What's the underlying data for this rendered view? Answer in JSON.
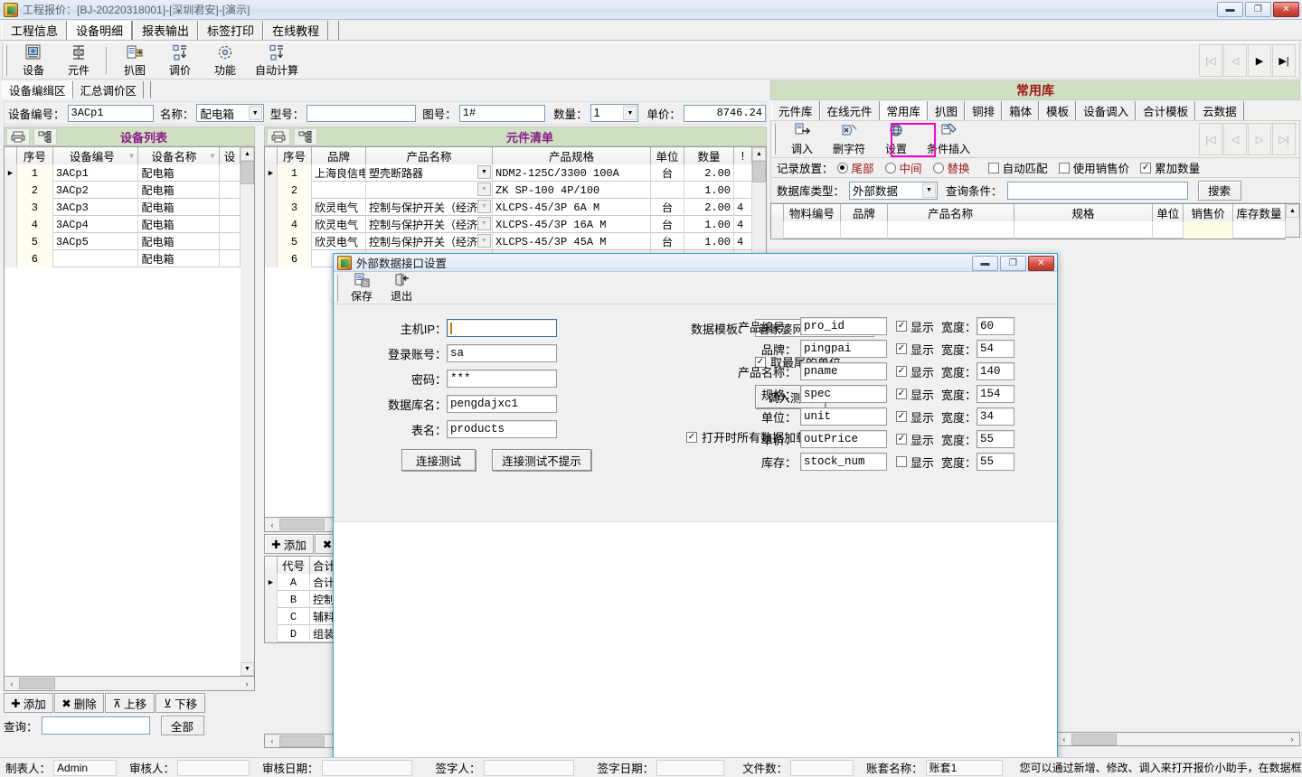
{
  "window": {
    "title": "工程报价：[BJ-20220318001]-[深圳君安]-[演示]",
    "minimize": "—",
    "maximize": "❐",
    "close": "✕"
  },
  "menu_tabs": [
    {
      "label": "工程信息",
      "active": false
    },
    {
      "label": "设备明细",
      "active": true
    },
    {
      "label": "报表输出",
      "active": false
    },
    {
      "label": "标签打印",
      "active": false
    },
    {
      "label": "在线教程",
      "active": false
    }
  ],
  "toolbar": {
    "buttons": [
      {
        "label": "设备",
        "icon": "device-icon"
      },
      {
        "label": "元件",
        "icon": "component-icon"
      },
      {
        "label": "扒图",
        "icon": "extract-image-icon"
      },
      {
        "label": "调价",
        "icon": "price-adjust-icon"
      },
      {
        "label": "功能",
        "icon": "function-icon"
      },
      {
        "label": "自动计算",
        "icon": "auto-calc-icon"
      }
    ],
    "nav": [
      {
        "label": "|◁",
        "name": "nav-first-button",
        "dim": true
      },
      {
        "label": "◁",
        "name": "nav-prev-button",
        "dim": true
      },
      {
        "label": "▶",
        "name": "nav-next-button",
        "dim": false
      },
      {
        "label": "▶|",
        "name": "nav-last-button",
        "dim": false
      }
    ]
  },
  "sub_tabs": [
    {
      "label": "设备编缉区",
      "active": true
    },
    {
      "label": "汇总调价区",
      "active": false
    }
  ],
  "field_row": {
    "device_no_label": "设备编号：",
    "device_no_value": "3ACp1",
    "name_label": "名称：",
    "name_value": "配电箱",
    "model_label": "型号：",
    "model_value": "",
    "drawing_label": "图号：",
    "drawing_value": "1#",
    "qty_label": "数量：",
    "qty_value": "1",
    "price_label": "单价：",
    "price_value": "8746.24"
  },
  "device_panel": {
    "title": "设备列表",
    "columns": [
      "",
      "序号",
      "设备编号",
      "设备名称",
      "设"
    ],
    "rows": [
      {
        "mark": "▶",
        "seq": "1",
        "no": "3ACp1",
        "name": "配电箱",
        "extra": ""
      },
      {
        "mark": "",
        "seq": "2",
        "no": "3ACp2",
        "name": "配电箱",
        "extra": ""
      },
      {
        "mark": "",
        "seq": "3",
        "no": "3ACp3",
        "name": "配电箱",
        "extra": ""
      },
      {
        "mark": "",
        "seq": "4",
        "no": "3ACp4",
        "name": "配电箱",
        "extra": ""
      },
      {
        "mark": "",
        "seq": "5",
        "no": "3ACp5",
        "name": "配电箱",
        "extra": ""
      },
      {
        "mark": "",
        "seq": "6",
        "no": "",
        "name": "配电箱",
        "extra": ""
      }
    ],
    "buttons": [
      {
        "label": "添加",
        "icon": "plus-icon"
      },
      {
        "label": "删除",
        "icon": "cross-icon"
      },
      {
        "label": "上移",
        "icon": "move-up-icon"
      },
      {
        "label": "下移",
        "icon": "move-down-icon"
      }
    ],
    "query_label": "查询：",
    "query_value": "",
    "all_button": "全部"
  },
  "component_panel": {
    "title": "元件清单",
    "columns": [
      "",
      "序号",
      "品牌",
      "产品名称",
      "产品规格",
      "单位",
      "数量",
      "!"
    ],
    "rows": [
      {
        "mark": "▶",
        "seq": "1",
        "brand": "上海良信电",
        "pname": "塑壳断路器",
        "spec": "NDM2-125C/3300 100A",
        "unit": "台",
        "qty": "2.00",
        "extra": "",
        "drop": true
      },
      {
        "mark": "",
        "seq": "2",
        "brand": "",
        "pname": "",
        "spec": "ZK SP-100 4P/100",
        "unit": "",
        "qty": "1.00",
        "extra": "",
        "drop": true,
        "dropDim": true
      },
      {
        "mark": "",
        "seq": "3",
        "brand": "欣灵电气",
        "pname": "控制与保护开关（经济",
        "spec": "XLCPS-45/3P 6A M",
        "unit": "台",
        "qty": "2.00",
        "extra": "4",
        "drop": true,
        "dropDim": true
      },
      {
        "mark": "",
        "seq": "4",
        "brand": "欣灵电气",
        "pname": "控制与保护开关（经济",
        "spec": "XLCPS-45/3P 16A M",
        "unit": "台",
        "qty": "1.00",
        "extra": "4",
        "drop": true,
        "dropDim": true
      },
      {
        "mark": "",
        "seq": "5",
        "brand": "欣灵电气",
        "pname": "控制与保护开关（经济",
        "spec": "XLCPS-45/3P 45A M",
        "unit": "台",
        "qty": "1.00",
        "extra": "4",
        "drop": true,
        "dropDim": true
      },
      {
        "mark": "",
        "seq": "6",
        "brand": "",
        "pname": "",
        "spec": "",
        "unit": "",
        "qty": "",
        "extra": "",
        "drop": false
      }
    ],
    "buttons": [
      {
        "label": "添加",
        "icon": "plus-icon"
      },
      {
        "label": "删除",
        "icon": "cross-icon"
      }
    ],
    "sub_grid": {
      "columns": [
        "",
        "代号",
        "合计"
      ],
      "rows": [
        {
          "mark": "▶",
          "code": "A",
          "name": "合计"
        },
        {
          "mark": "",
          "code": "B",
          "name": "控制"
        },
        {
          "mark": "",
          "code": "C",
          "name": "辅料"
        },
        {
          "mark": "",
          "code": "D",
          "name": "组装"
        }
      ]
    }
  },
  "right_panel": {
    "header": "常用库",
    "tabs": [
      {
        "label": "元件库",
        "active": false
      },
      {
        "label": "在线元件",
        "active": false
      },
      {
        "label": "常用库",
        "active": true
      },
      {
        "label": "扒图",
        "active": false
      },
      {
        "label": "铜排",
        "active": false
      },
      {
        "label": "箱体",
        "active": false
      },
      {
        "label": "模板",
        "active": false
      },
      {
        "label": "设备调入",
        "active": false
      },
      {
        "label": "合计模板",
        "active": false
      },
      {
        "label": "云数据",
        "active": false
      }
    ],
    "tools": [
      {
        "label": "调入",
        "icon": "import-icon",
        "highlighted": false
      },
      {
        "label": "删字符",
        "icon": "delete-char-icon",
        "highlighted": false
      },
      {
        "label": "设置",
        "icon": "globe-settings-icon",
        "highlighted": true
      },
      {
        "label": "条件插入",
        "icon": "conditional-insert-icon",
        "highlighted": false
      }
    ],
    "nav": [
      {
        "label": "|◁",
        "name": "lib-nav-first-button"
      },
      {
        "label": "◁",
        "name": "lib-nav-prev-button"
      },
      {
        "label": "▷",
        "name": "lib-nav-next-button"
      },
      {
        "label": "▷|",
        "name": "lib-nav-last-button"
      }
    ],
    "placement_label": "记录放置：",
    "placement_options": [
      {
        "label": "尾部",
        "checked": true
      },
      {
        "label": "中间",
        "checked": false
      },
      {
        "label": "替换",
        "checked": false
      }
    ],
    "checkboxes": [
      {
        "label": "自动匹配",
        "checked": false
      },
      {
        "label": "使用销售价",
        "checked": false
      },
      {
        "label": "累加数量",
        "checked": true
      }
    ],
    "db_type_label": "数据库类型：",
    "db_type_value": "外部数据",
    "query_label": "查询条件：",
    "query_value": "",
    "search_button": "搜索",
    "result_columns": [
      "",
      "物料编号",
      "品牌",
      "产品名称",
      "规格",
      "单位",
      "销售价",
      "库存数量"
    ],
    "result_rows": [
      {
        "mark": "",
        "c1": "",
        "c2": "",
        "c3": "",
        "c4": "",
        "c5": "",
        "c6": "",
        "c7": ""
      }
    ]
  },
  "dialog": {
    "title": "外部数据接口设置",
    "minimize": "—",
    "maximize": "❐",
    "close": "✕",
    "toolbar": [
      {
        "label": "保存",
        "icon": "save-icon"
      },
      {
        "label": "退出",
        "icon": "exit-icon"
      }
    ],
    "left_fields": [
      {
        "label": "主机IP：",
        "value": "",
        "name": "host-ip-field",
        "focused": true
      },
      {
        "label": "登录账号：",
        "value": "sa",
        "name": "login-account-field",
        "focused": false
      },
      {
        "label": "密码：",
        "value": "***",
        "name": "password-field",
        "focused": false
      },
      {
        "label": "数据库名：",
        "value": "pengdajxc1",
        "name": "database-name-field",
        "focused": false
      },
      {
        "label": "表名：",
        "value": "products",
        "name": "table-name-field",
        "focused": false
      }
    ],
    "left_buttons": [
      {
        "label": "连接测试",
        "name": "connection-test-button"
      },
      {
        "label": "连接测试不提示",
        "name": "connection-test-silent-button"
      }
    ],
    "template_label": "数据模板：",
    "template_value": "管家婆网络版",
    "tail_unit_checkbox": {
      "label": "取最尾的单位",
      "checked": true
    },
    "import_test_button": "调入测试",
    "cache_checkbox": {
      "label": "打开时所有数据加载到缓存",
      "checked": true
    },
    "mapping_show_label": "显示",
    "mapping_width_label": "宽度：",
    "mappings": [
      {
        "label": "产品编号：",
        "field": "pro_id",
        "show": true,
        "width": "60"
      },
      {
        "label": "品牌：",
        "field": "pingpai",
        "show": true,
        "width": "54"
      },
      {
        "label": "产品名称：",
        "field": "pname",
        "show": true,
        "width": "140"
      },
      {
        "label": "规格：",
        "field": "spec",
        "show": true,
        "width": "154"
      },
      {
        "label": "单位：",
        "field": "unit",
        "show": true,
        "width": "34"
      },
      {
        "label": "单价：",
        "field": "outPrice",
        "show": true,
        "width": "55"
      },
      {
        "label": "库存：",
        "field": "stock_num",
        "show": false,
        "width": "55"
      }
    ]
  },
  "status_bar": {
    "maker_label": "制表人：",
    "maker_value": "Admin",
    "auditor_label": "审核人：",
    "auditor_value": "",
    "audit_date_label": "审核日期：",
    "audit_date_value": "",
    "signer_label": "签字人：",
    "signer_value": "",
    "sign_date_label": "签字日期：",
    "sign_date_value": "",
    "file_count_label": "文件数：",
    "file_count_value": "",
    "account_set_label": "账套名称：",
    "account_set_value": "账套1",
    "hint": "您可以通过新增、修改、调入来打开报价小助手，在数据框中按鼠标右键会有更多功"
  },
  "colors": {
    "panel_header_bg": "#cfe0c1",
    "panel_title_purple": "#8b1a8b",
    "panel_title_red": "#a01818",
    "highlight_magenta": "#ff00cc",
    "accent_blue": "#2f9fd0"
  }
}
